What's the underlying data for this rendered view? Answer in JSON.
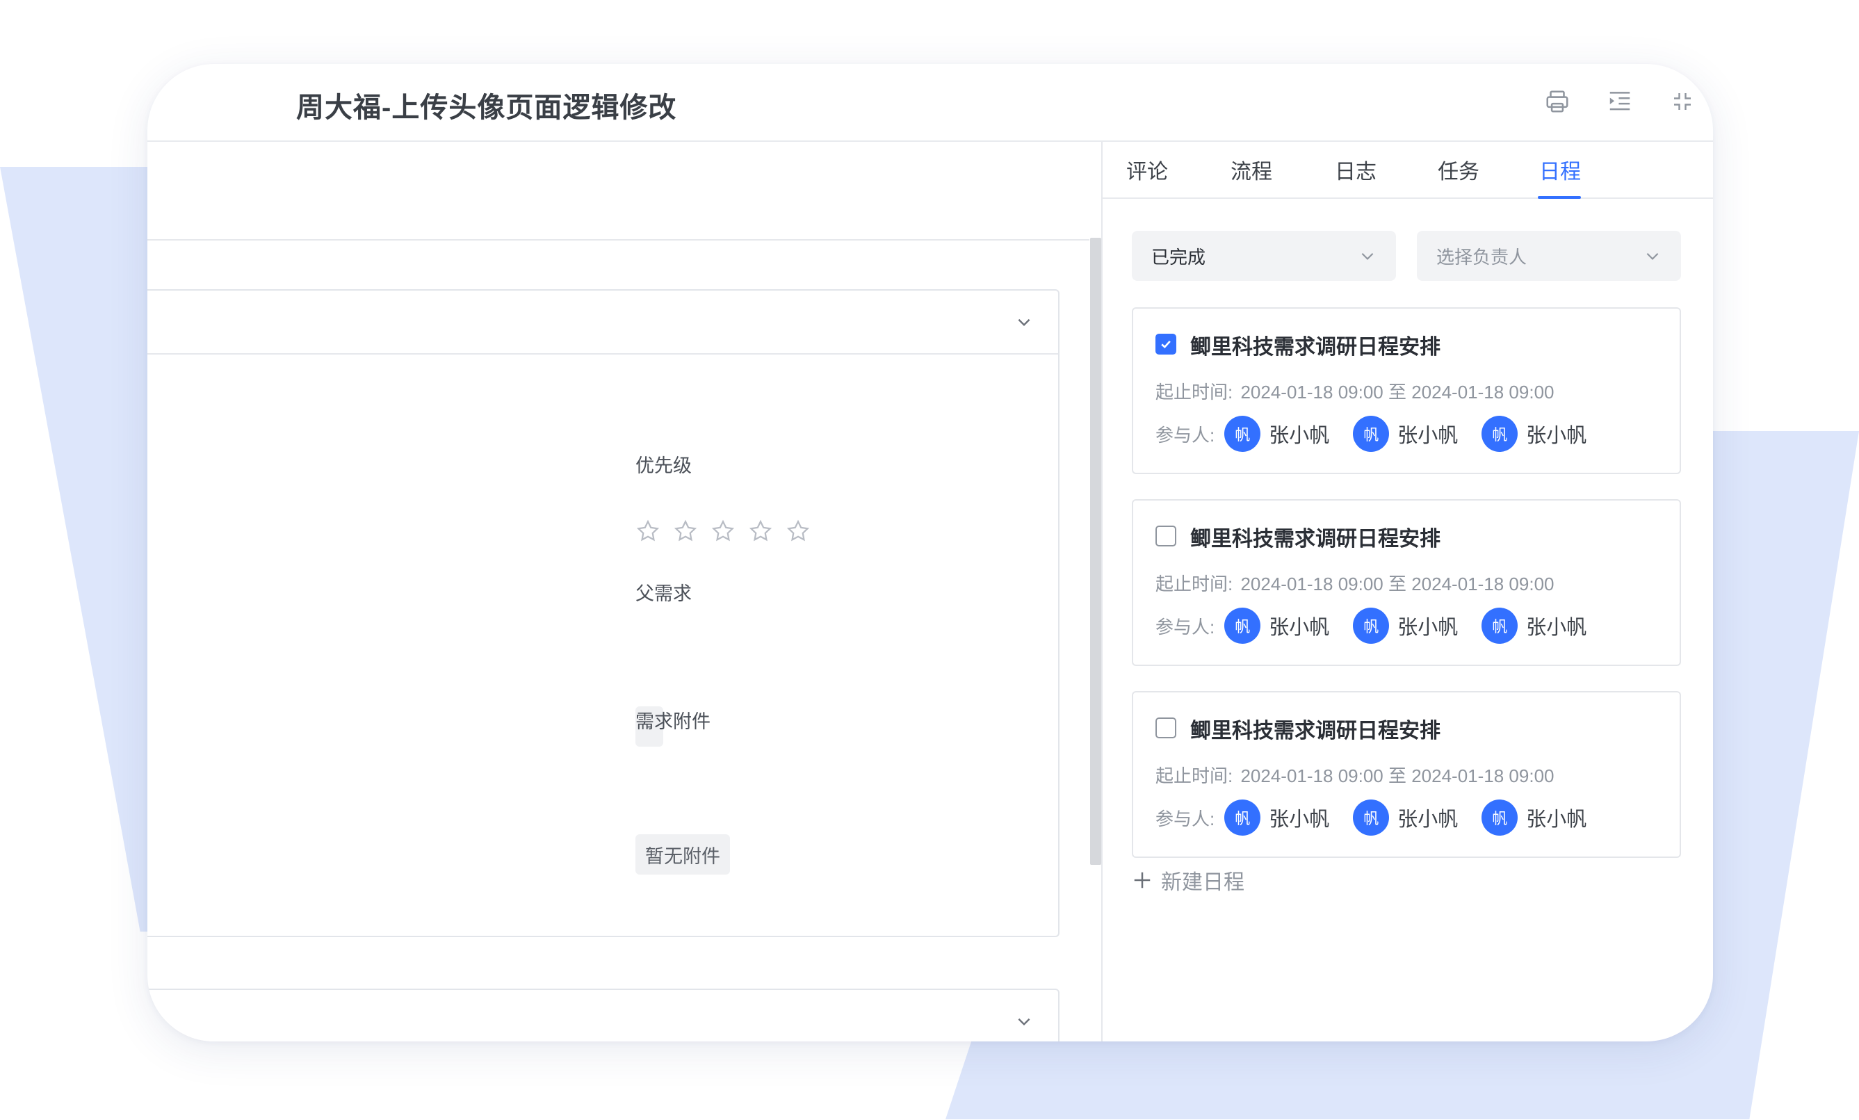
{
  "window": {
    "title": "周大福-上传头像页面逻辑修改",
    "icons": [
      "print-icon",
      "outline-icon",
      "collapse-icon",
      "close-icon"
    ]
  },
  "detail": {
    "priority_label": "优先级",
    "priority_stars": 0,
    "priority_max": 5,
    "parent_label": "父需求",
    "parent_value": "-",
    "attachment_label": "需求附件",
    "attachment_value": "暂无附件"
  },
  "tabs": [
    {
      "label": "评论",
      "active": false
    },
    {
      "label": "流程",
      "active": false
    },
    {
      "label": "日志",
      "active": false
    },
    {
      "label": "任务",
      "active": false
    },
    {
      "label": "日程",
      "active": true
    }
  ],
  "filters": {
    "status_value": "已完成",
    "owner_placeholder": "选择负责人"
  },
  "schedules": [
    {
      "checked": true,
      "title": "鲫里科技需求调研日程安排",
      "time_label": "起止时间:",
      "time_value": "2024-01-18 09:00 至 2024-01-18 09:00",
      "participants_label": "参与人:",
      "participants": [
        {
          "avatar": "帆",
          "name": "张小帆"
        },
        {
          "avatar": "帆",
          "name": "张小帆"
        },
        {
          "avatar": "帆",
          "name": "张小帆"
        }
      ]
    },
    {
      "checked": false,
      "title": "鲫里科技需求调研日程安排",
      "time_label": "起止时间:",
      "time_value": "2024-01-18 09:00 至 2024-01-18 09:00",
      "participants_label": "参与人:",
      "participants": [
        {
          "avatar": "帆",
          "name": "张小帆"
        },
        {
          "avatar": "帆",
          "name": "张小帆"
        },
        {
          "avatar": "帆",
          "name": "张小帆"
        }
      ]
    },
    {
      "checked": false,
      "title": "鲫里科技需求调研日程安排",
      "time_label": "起止时间:",
      "time_value": "2024-01-18 09:00 至 2024-01-18 09:00",
      "participants_label": "参与人:",
      "participants": [
        {
          "avatar": "帆",
          "name": "张小帆"
        },
        {
          "avatar": "帆",
          "name": "张小帆"
        },
        {
          "avatar": "帆",
          "name": "张小帆"
        }
      ]
    }
  ],
  "new_schedule_label": "新建日程",
  "colors": {
    "accent": "#3370ff",
    "background_shape": "#dde6fb"
  }
}
